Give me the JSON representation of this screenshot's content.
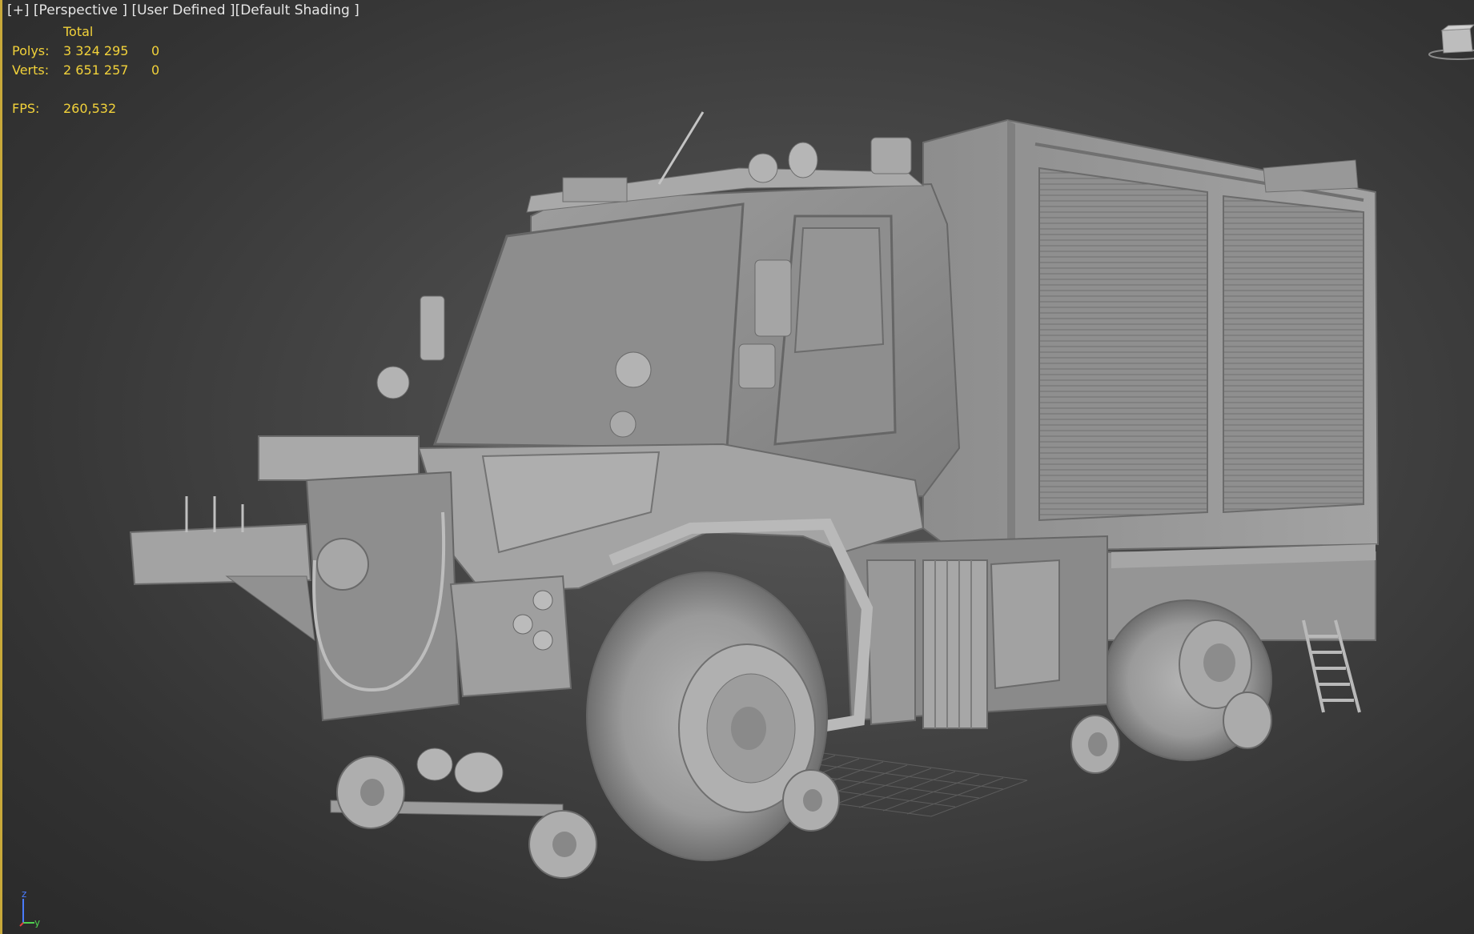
{
  "viewport": {
    "label_plus": "[+]",
    "label_view": "[Perspective ]",
    "label_user": "[User Defined ]",
    "label_shading": "[Default Shading ]"
  },
  "stats": {
    "header": "Total",
    "polys_label": "Polys:",
    "polys_total": "3 324 295",
    "polys_sel": "0",
    "verts_label": "Verts:",
    "verts_total": "2 651 257",
    "verts_sel": "0",
    "fps_label": "FPS:",
    "fps_value": "260,532"
  },
  "axis": {
    "z": "z",
    "y": "y"
  },
  "colors": {
    "stats_text": "#f2d23a",
    "viewport_border": "#c8a93a",
    "axis_z": "#4a7bff",
    "axis_y": "#4fd14f"
  }
}
